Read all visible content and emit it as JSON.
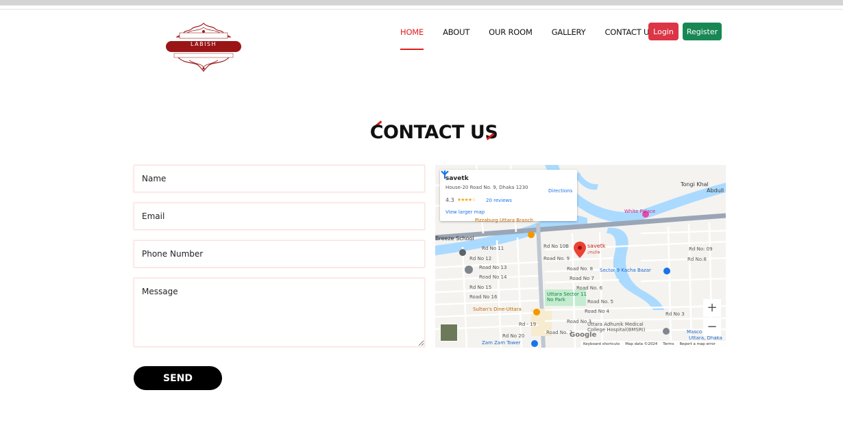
{
  "brand": {
    "name": "LABISH",
    "logo_alt": "Labish Hotel & Resort logo"
  },
  "nav": {
    "items": [
      {
        "label": "HOME",
        "active": true
      },
      {
        "label": "ABOUT",
        "active": false
      },
      {
        "label": "OUR ROOM",
        "active": false
      },
      {
        "label": "GALLERY",
        "active": false
      },
      {
        "label": "CONTACT US",
        "active": false
      }
    ],
    "login_label": "Login",
    "register_label": "Register"
  },
  "page": {
    "title": "CONTACT US"
  },
  "form": {
    "name_placeholder": "Name",
    "email_placeholder": "Email",
    "phone_placeholder": "Phone Number",
    "message_placeholder": "Message",
    "send_label": "SEND"
  },
  "map": {
    "place_name": "savetk",
    "address": "House-20 Road No. 9, Dhaka 1230",
    "rating": "4.3",
    "stars": "★★★★☆",
    "reviews": "20 reviews",
    "larger_map": "View larger map",
    "directions": "Directions",
    "marker_label": "savetk",
    "marker_sublabel": "সেভটক",
    "labels": {
      "tongi_khal": "Tongi Khal",
      "abdull": "Abdull",
      "white_palace": "White Palace",
      "pizzaburg": "Pizzaburg Uttara Branch",
      "breeze_school": "Breeze School",
      "rd_no_11": "Rd No 11",
      "rd_no_12": "Rd No 12",
      "road_no_13": "Road No 13",
      "road_no_14": "Road No 14",
      "rd_no_15": "Rd No 15",
      "road_no_16": "Road No 16",
      "rd_no_10b": "Rd No 10B",
      "road_no_9": "Road No. 9",
      "road_no_8": "Road No. 8",
      "road_no_7": "Road No 7",
      "road_no_6": "Road No. 6",
      "road_no_5": "Road No. 5",
      "road_no_4": "Road No 4",
      "road_no_3": "Road No 3",
      "road_no_2": "Road No. 2",
      "rd_no_20": "Rd No 20",
      "rd_19": "Rd - 19",
      "sector9": "Sector 9 Kacha Bazar",
      "sector11_park": "Uttara Sector 11 No Park",
      "sultans": "Sultan's Dine-Uttara",
      "uttara_adhunik": "Uttara Adhunik Medical College Hospital(BMSRI)",
      "zamzam": "Zam Zam Tower",
      "masco": "Masco",
      "uttara": "Uttara, Dhaka",
      "rd_no_09": "Rd No: 09",
      "rd_no_8": "Rd No:8",
      "rd_no_3": "Rd No 3"
    },
    "footer": {
      "shortcuts": "Keyboard shortcuts",
      "mapdata": "Map data ©2024",
      "terms": "Terms",
      "report": "Report a map error"
    },
    "google": "Google"
  },
  "colors": {
    "accent": "#e01b1b",
    "login": "#dc3545",
    "register": "#198754",
    "water": "#aadaff"
  }
}
